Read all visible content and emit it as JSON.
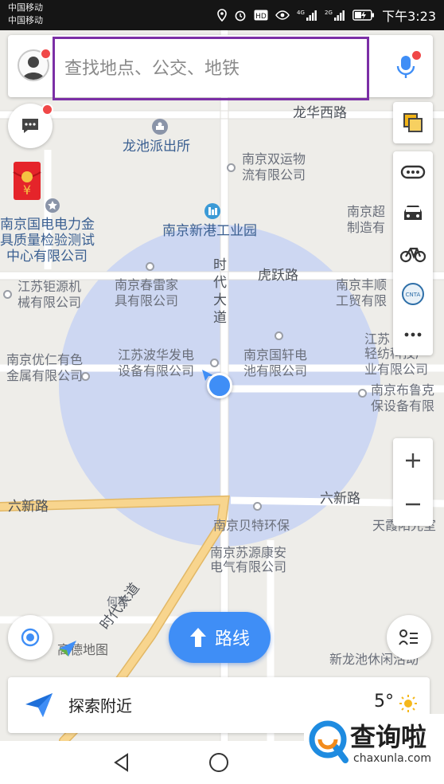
{
  "status_bar": {
    "carrier_1": "中国移动",
    "carrier_2": "中国移动",
    "time": "下午3:23"
  },
  "search": {
    "placeholder": "查找地点、公交、地铁"
  },
  "map": {
    "roads": [
      "龙华西路",
      "虎跃路",
      "六新路",
      "六新路",
      "时代大道",
      "时代大道"
    ],
    "places": {
      "police": "龙池派出所",
      "shuangyun_1": "南京双运物",
      "shuangyun_2": "流有限公司",
      "guodian_1": "南京国电电力金",
      "guodian_2": "具质量检验测试",
      "guodian_3": "中心有限公司",
      "xingang": "南京新港工业园",
      "chaoji_1": "南京超",
      "chaoji_2": "制造有",
      "chunlei_1": "南京春雷家",
      "chunlei_2": "具有限公司",
      "juyuan_1": "江苏钜源机",
      "juyuan_2": "械有限公司",
      "fengshun_1": "南京丰顺",
      "fengshun_2": "工贸有限",
      "jiangsu_fz_1": "江苏",
      "jiangsu_fz_2": "轻纺科技产",
      "jiangsu_fz_3": "业有限公司",
      "youren_1": "南京优仁有色",
      "youren_2": "金属有限公司",
      "bohua_1": "江苏波华发电",
      "bohua_2": "设备有限公司",
      "guoxuan_1": "南京国轩电",
      "guoxuan_2": "池有限公司",
      "bulu_1": "南京布鲁克",
      "bulu_2": "保设备有限",
      "beite": "南京贝特环保",
      "sumyuan_1": "南京苏源康安",
      "sumyuan_2": "电气有限公司",
      "tianxia": "天霞阳光室",
      "heying": "何营",
      "xinlongchi": "新龙池休闲活动"
    },
    "logo_text": "高德地图"
  },
  "route_button": {
    "label": "路线"
  },
  "explore": {
    "label": "探索附近",
    "temperature": "5°"
  },
  "watermark": {
    "text": "查询啦",
    "url": "chaxunla.com"
  },
  "colors": {
    "accent_blue": "#3f8ef6",
    "search_highlight": "#7b2fa6",
    "location_circle": "#c7d2f3",
    "major_road": "#f5d08a"
  }
}
